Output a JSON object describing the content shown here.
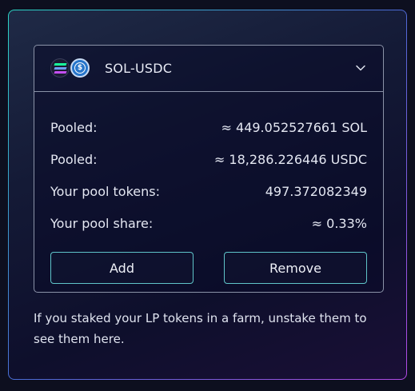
{
  "pool": {
    "pair_name": "SOL-USDC",
    "token_icons": [
      "sol-icon",
      "usdc-icon"
    ],
    "expanded": true
  },
  "details": [
    {
      "label": "Pooled:",
      "value": "≈ 449.052527661 SOL"
    },
    {
      "label": "Pooled:",
      "value": "≈ 18,286.226446 USDC"
    },
    {
      "label": "Your pool tokens:",
      "value": "497.372082349"
    },
    {
      "label": "Your pool share:",
      "value": "≈ 0.33%"
    }
  ],
  "actions": {
    "add_label": "Add",
    "remove_label": "Remove"
  },
  "note": "If you staked your LP tokens in a farm, unstake them to see them here.",
  "colors": {
    "accent_border": "#5fc4c9",
    "frame_gradient": [
      "#2bd6c4",
      "#4b6bd6",
      "#b34ae6"
    ],
    "text": "#e4e7f2"
  }
}
